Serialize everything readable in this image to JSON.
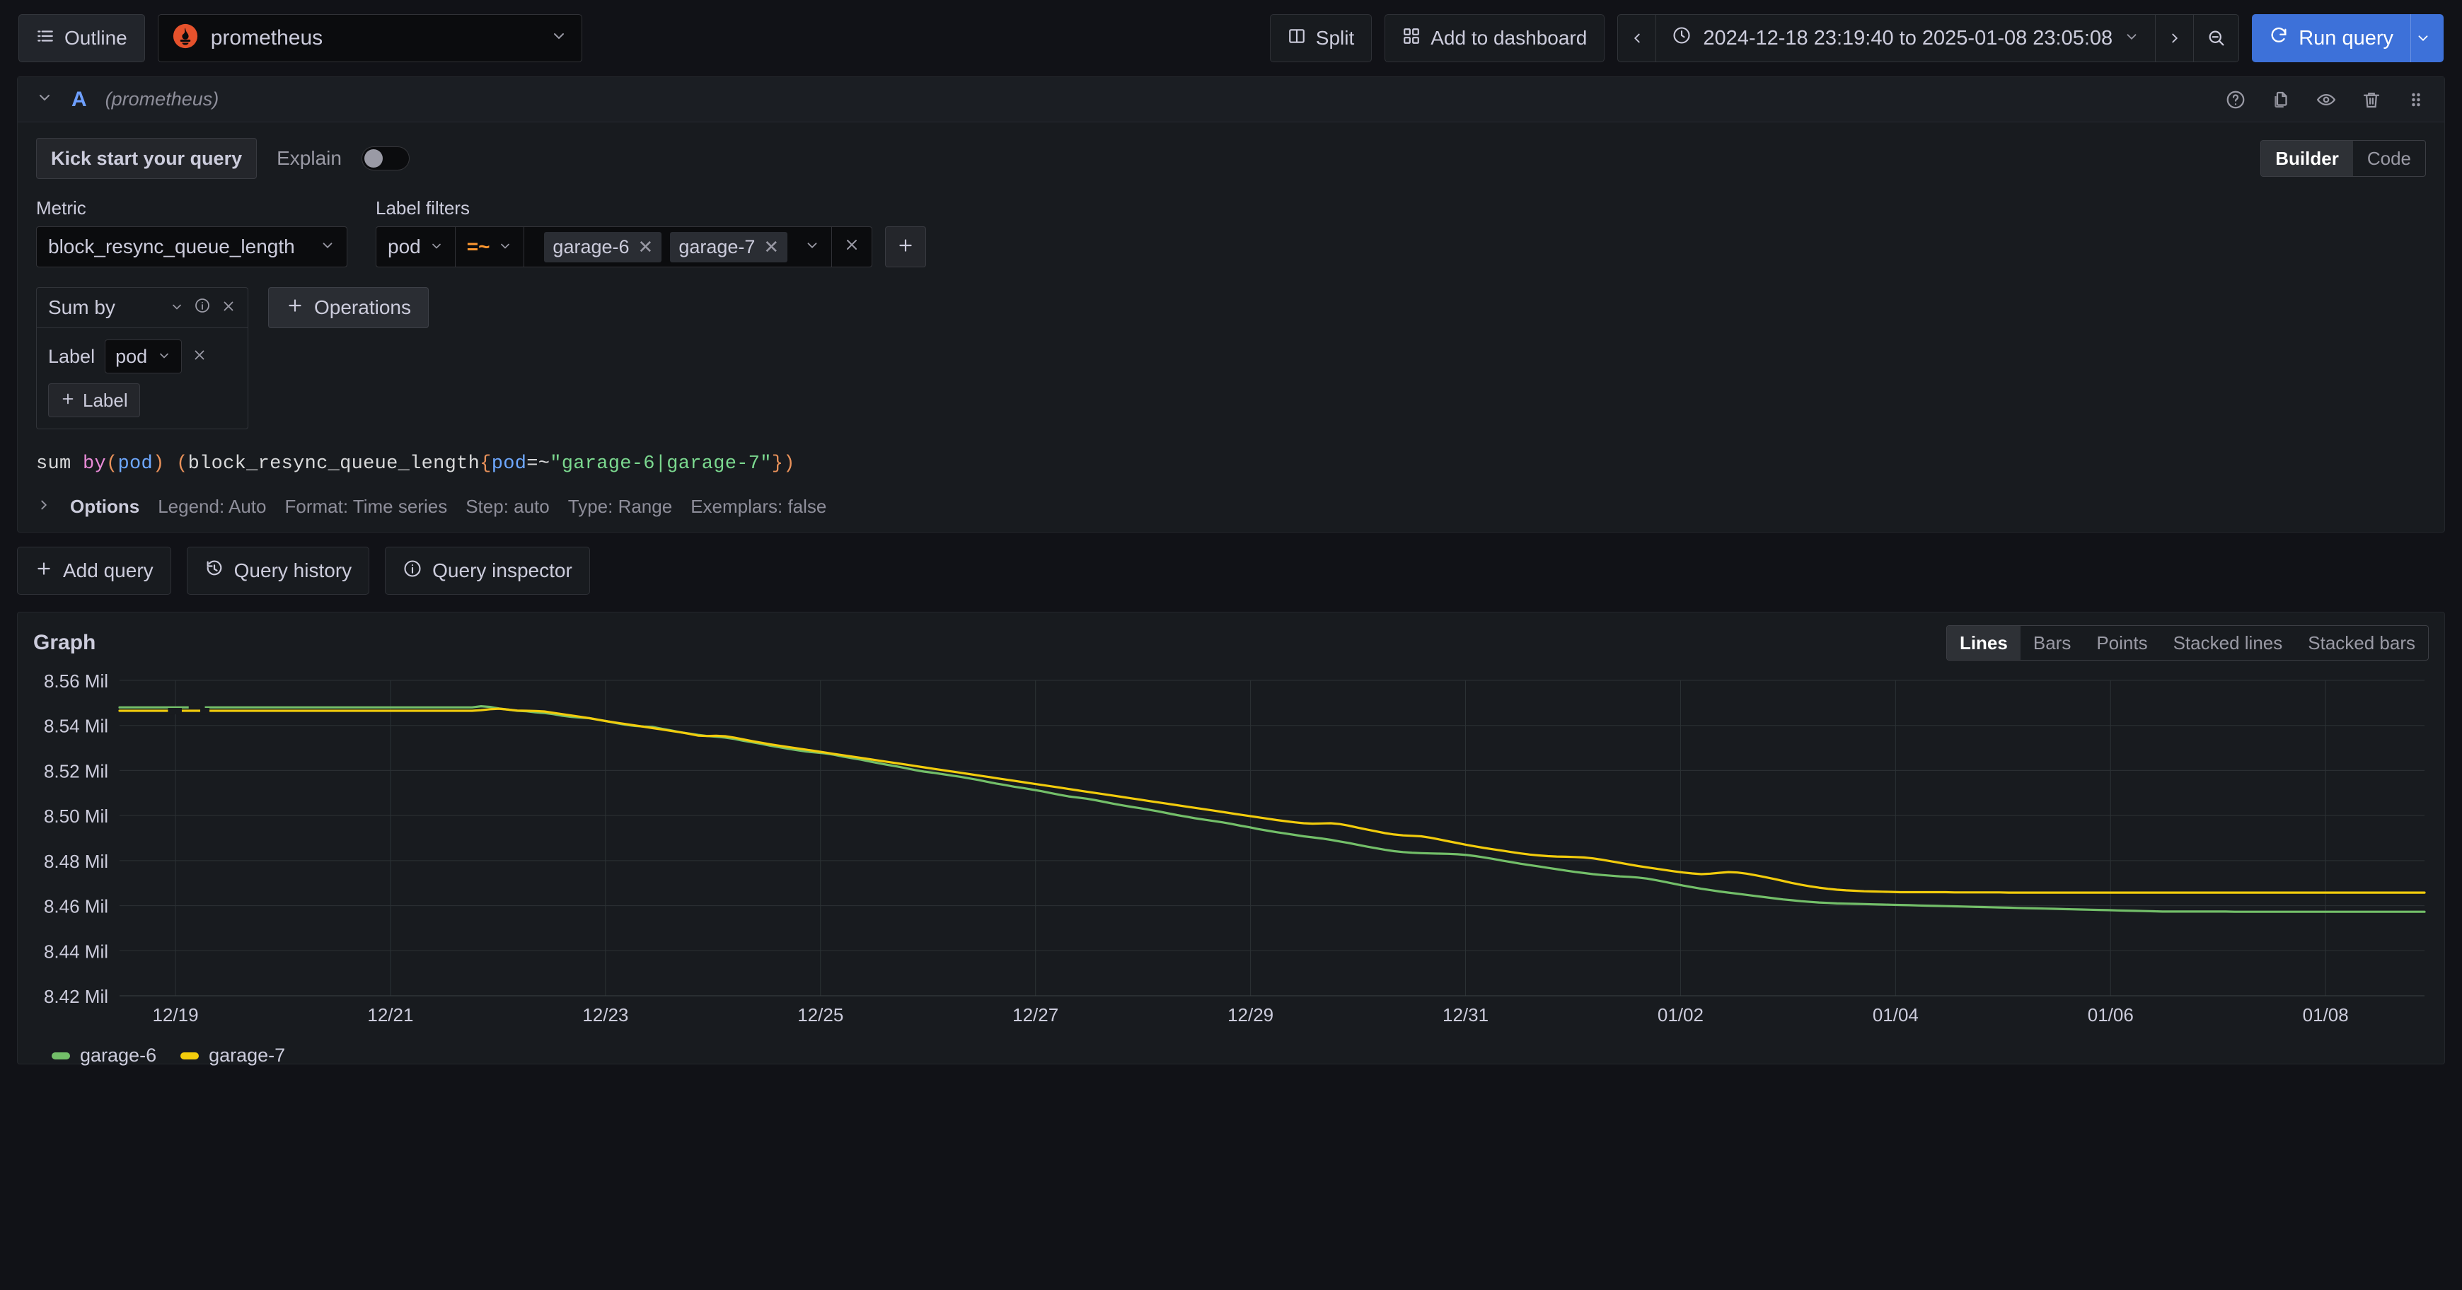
{
  "toolbar": {
    "outline_label": "Outline",
    "outline_icon": "list-icon",
    "datasource_name": "prometheus",
    "datasource_icon": "prometheus-logo-icon",
    "split_label": "Split",
    "split_icon": "split-panes-icon",
    "add_dashboard_label": "Add to dashboard",
    "add_dashboard_icon": "grid-apps-icon",
    "time_prev_icon": "chevron-left-icon",
    "time_next_icon": "chevron-right-icon",
    "time_clock_icon": "clock-icon",
    "time_range": "2024-12-18 23:19:40 to 2025-01-08 23:05:08",
    "zoom_out_icon": "zoom-out-icon",
    "run_query_label": "Run query",
    "run_query_icon": "refresh-icon",
    "run_query_color": "#3d71d9"
  },
  "query": {
    "collapse_icon": "chevron-down-icon",
    "ref_id": "A",
    "datasource": "(prometheus)",
    "icons": [
      "help-circle-icon",
      "copy-icon",
      "eye-icon",
      "trash-icon",
      "drag-handle-icon"
    ],
    "kick_start_label": "Kick start your query",
    "explain_label": "Explain",
    "explain_on": false,
    "editor_modes": [
      "Builder",
      "Code"
    ],
    "editor_mode_active": "Builder",
    "metric_label": "Metric",
    "metric_value": "block_resync_queue_length",
    "label_filters_label": "Label filters",
    "filter_label": "pod",
    "filter_operator": "=~",
    "filter_operator_color": "#ff9830",
    "filter_values": [
      "garage-6",
      "garage-7"
    ],
    "filter_clear_icon": "clear-x-icon",
    "filter_add_icon": "plus-icon",
    "operation": {
      "name": "Sum by",
      "info_icon": "info-circle-icon",
      "remove_icon": "close-x-icon",
      "label_text": "Label",
      "label_value": "pod",
      "label_remove_icon": "close-x-icon",
      "add_label_button": "Label",
      "add_label_icon": "plus-icon"
    },
    "operations_button": "Operations",
    "operations_icon": "plus-icon",
    "promql": {
      "t1": "sum ",
      "t2": "by",
      "t3": "(",
      "t4": "pod",
      "t5": ")",
      "t6": " (",
      "t7": "block_resync_queue_length",
      "t8": "{",
      "t9": "pod",
      "t10": "=~",
      "t11": "\"garage-6|garage-7\"",
      "t12": "}",
      "t13": ")"
    },
    "options_toggle_icon": "chevron-right-icon",
    "options_title": "Options",
    "options_meta": [
      "Legend: Auto",
      "Format: Time series",
      "Step: auto",
      "Type: Range",
      "Exemplars: false"
    ]
  },
  "actions": {
    "add_query": "Add query",
    "add_query_icon": "plus-icon",
    "query_history": "Query history",
    "query_history_icon": "history-icon",
    "query_inspector": "Query inspector",
    "query_inspector_icon": "info-circle-icon"
  },
  "graph": {
    "title": "Graph",
    "viz_types": [
      "Lines",
      "Bars",
      "Points",
      "Stacked lines",
      "Stacked bars"
    ],
    "viz_active": "Lines"
  },
  "chart_data": {
    "type": "line",
    "title": "Graph",
    "xlabel": "",
    "ylabel": "",
    "grid": true,
    "legend_position": "bottom-left",
    "ytick_labels": [
      "8.56 Mil",
      "8.54 Mil",
      "8.52 Mil",
      "8.50 Mil",
      "8.48 Mil",
      "8.46 Mil",
      "8.44 Mil",
      "8.42 Mil"
    ],
    "yticks": [
      8560000,
      8540000,
      8520000,
      8500000,
      8480000,
      8460000,
      8440000,
      8420000
    ],
    "ylim": [
      8420000,
      8560000
    ],
    "xtick_labels": [
      "12/19",
      "12/21",
      "12/23",
      "12/25",
      "12/27",
      "12/29",
      "12/31",
      "01/02",
      "01/04",
      "01/06",
      "01/08"
    ],
    "xlim": [
      "2024-12-18 23:19:40",
      "2025-01-08 23:05:08"
    ],
    "series": [
      {
        "name": "garage-6",
        "color": "#73bf69",
        "values": [
          8548000,
          8548000,
          8548000,
          8548000,
          8548000,
          8548000,
          8548000,
          8548000,
          8548000,
          8548000,
          8548000,
          8548000,
          8548000,
          8548000,
          8548000,
          8548000,
          8548000,
          8548000,
          8548000,
          8548000,
          8548000,
          8548000,
          8548000,
          8548000,
          8548000,
          8548000,
          8548000,
          8548000,
          8548000,
          8548000,
          8548000,
          8548000,
          8548000,
          8548000,
          8548000,
          8548000,
          8548000,
          8548000,
          8548000,
          8548000,
          8548500,
          8548200,
          8547500,
          8547000,
          8546500,
          8546300,
          8545800,
          8545500,
          8545000,
          8544300,
          8543800,
          8543500,
          8543200,
          8542500,
          8541800,
          8541000,
          8540300,
          8539800,
          8539500,
          8539300,
          8538500,
          8537800,
          8537000,
          8536400,
          8535800,
          8535300,
          8535000,
          8534600,
          8534000,
          8533200,
          8532500,
          8531800,
          8531000,
          8530300,
          8529600,
          8529000,
          8528400,
          8528000,
          8527600,
          8527000,
          8526200,
          8525500,
          8524800,
          8524000,
          8523200,
          8522500,
          8521800,
          8521000,
          8520200,
          8519500,
          8519000,
          8518400,
          8517800,
          8517200,
          8516500,
          8515800,
          8515000,
          8514200,
          8513500,
          8512800,
          8512200,
          8511500,
          8510800,
          8510000,
          8509200,
          8508500,
          8508000,
          8507500,
          8506800,
          8506000,
          8505200,
          8504500,
          8503800,
          8503200,
          8502500,
          8501800,
          8501000,
          8500200,
          8499500,
          8498800,
          8498200,
          8497600,
          8497000,
          8496300,
          8495500,
          8494800,
          8494000,
          8493300,
          8492600,
          8492000,
          8491400,
          8490800,
          8490300,
          8489800,
          8489200,
          8488500,
          8487800,
          8487000,
          8486200,
          8485500,
          8484800,
          8484200,
          8483800,
          8483500,
          8483300,
          8483200,
          8483100,
          8483000,
          8482800,
          8482500,
          8482000,
          8481400,
          8480700,
          8480000,
          8479300,
          8478600,
          8478000,
          8477400,
          8476800,
          8476200,
          8475600,
          8475000,
          8474500,
          8474000,
          8473600,
          8473300,
          8473000,
          8472800,
          8472500,
          8472000,
          8471300,
          8470500,
          8469700,
          8468900,
          8468200,
          8467500,
          8466900,
          8466300,
          8465800,
          8465300,
          8464800,
          8464300,
          8463800,
          8463300,
          8462800,
          8462400,
          8462000,
          8461700,
          8461400,
          8461200,
          8461000,
          8460900,
          8460800,
          8460700,
          8460600,
          8460500,
          8460400,
          8460300,
          8460200,
          8460100,
          8460000,
          8459900,
          8459800,
          8459700,
          8459600,
          8459500,
          8459400,
          8459300,
          8459200,
          8459100,
          8459000,
          8458900,
          8458800,
          8458700,
          8458600,
          8458500,
          8458400,
          8458300,
          8458200,
          8458100,
          8458000,
          8457900,
          8457800,
          8457700,
          8457600,
          8457500,
          8457400,
          8457400,
          8457400,
          8457400,
          8457400,
          8457400,
          8457400,
          8457400,
          8457300,
          8457300,
          8457300,
          8457300,
          8457300,
          8457300,
          8457300,
          8457300,
          8457300,
          8457300,
          8457300,
          8457300,
          8457300,
          8457300,
          8457300,
          8457300,
          8457300,
          8457300,
          8457300,
          8457300,
          8457300,
          8457300
        ]
      },
      {
        "name": "garage-7",
        "color": "#f2cc0c",
        "values": [
          8546500,
          8546500,
          8546500,
          8546500,
          8546500,
          8546500,
          8546500,
          8546500,
          8546500,
          8546500,
          8546500,
          8546500,
          8546500,
          8546500,
          8546500,
          8546500,
          8546500,
          8546500,
          8546500,
          8546500,
          8546500,
          8546500,
          8546500,
          8546500,
          8546500,
          8546500,
          8546500,
          8546500,
          8546500,
          8546500,
          8546500,
          8546500,
          8546500,
          8546500,
          8546500,
          8546500,
          8546500,
          8546500,
          8546500,
          8546500,
          8546800,
          8547200,
          8547400,
          8547000,
          8546600,
          8546500,
          8546400,
          8546200,
          8545600,
          8545000,
          8544400,
          8543800,
          8543200,
          8542500,
          8541800,
          8541200,
          8540600,
          8540000,
          8539400,
          8538800,
          8538200,
          8537600,
          8537000,
          8536300,
          8535500,
          8535300,
          8535400,
          8535200,
          8534600,
          8533800,
          8533000,
          8532300,
          8531600,
          8531000,
          8530400,
          8529800,
          8529200,
          8528600,
          8528000,
          8527400,
          8526800,
          8526200,
          8525600,
          8525000,
          8524400,
          8523800,
          8523200,
          8522600,
          8522000,
          8521400,
          8520800,
          8520200,
          8519600,
          8519000,
          8518400,
          8517800,
          8517200,
          8516600,
          8516000,
          8515400,
          8514800,
          8514200,
          8513600,
          8513000,
          8512400,
          8511800,
          8511200,
          8510600,
          8510000,
          8509400,
          8508800,
          8508200,
          8507600,
          8507000,
          8506400,
          8505800,
          8505200,
          8504600,
          8504000,
          8503400,
          8502800,
          8502200,
          8501600,
          8501000,
          8500400,
          8499800,
          8499200,
          8498600,
          8498000,
          8497500,
          8497000,
          8496600,
          8496400,
          8496500,
          8496600,
          8496200,
          8495500,
          8494600,
          8493800,
          8493000,
          8492200,
          8491600,
          8491200,
          8491000,
          8490800,
          8490200,
          8489400,
          8488600,
          8487800,
          8487000,
          8486300,
          8485600,
          8485000,
          8484400,
          8483800,
          8483200,
          8482700,
          8482300,
          8482000,
          8481800,
          8481700,
          8481600,
          8481400,
          8481000,
          8480400,
          8479700,
          8479000,
          8478300,
          8477600,
          8477000,
          8476400,
          8475800,
          8475200,
          8474700,
          8474300,
          8474000,
          8474200,
          8474600,
          8474900,
          8474700,
          8474200,
          8473500,
          8472700,
          8471900,
          8471000,
          8470100,
          8469300,
          8468600,
          8468000,
          8467500,
          8467100,
          8466800,
          8466600,
          8466400,
          8466300,
          8466200,
          8466100,
          8466000,
          8466000,
          8466000,
          8466000,
          8466000,
          8466000,
          8465900,
          8465900,
          8465900,
          8465900,
          8465900,
          8465900,
          8465800,
          8465800,
          8465800,
          8465800,
          8465800,
          8465800,
          8465800,
          8465800,
          8465800,
          8465800,
          8465800,
          8465800,
          8465800,
          8465800,
          8465800,
          8465800,
          8465800,
          8465800,
          8465800,
          8465800,
          8465800,
          8465800,
          8465800,
          8465800,
          8465800,
          8465800,
          8465800,
          8465800,
          8465800,
          8465800,
          8465800,
          8465800,
          8465800,
          8465800,
          8465800,
          8465800,
          8465800,
          8465800,
          8465800,
          8465800,
          8465800,
          8465800,
          8465800,
          8465800,
          8465800,
          8465800,
          8465800
        ]
      }
    ]
  }
}
